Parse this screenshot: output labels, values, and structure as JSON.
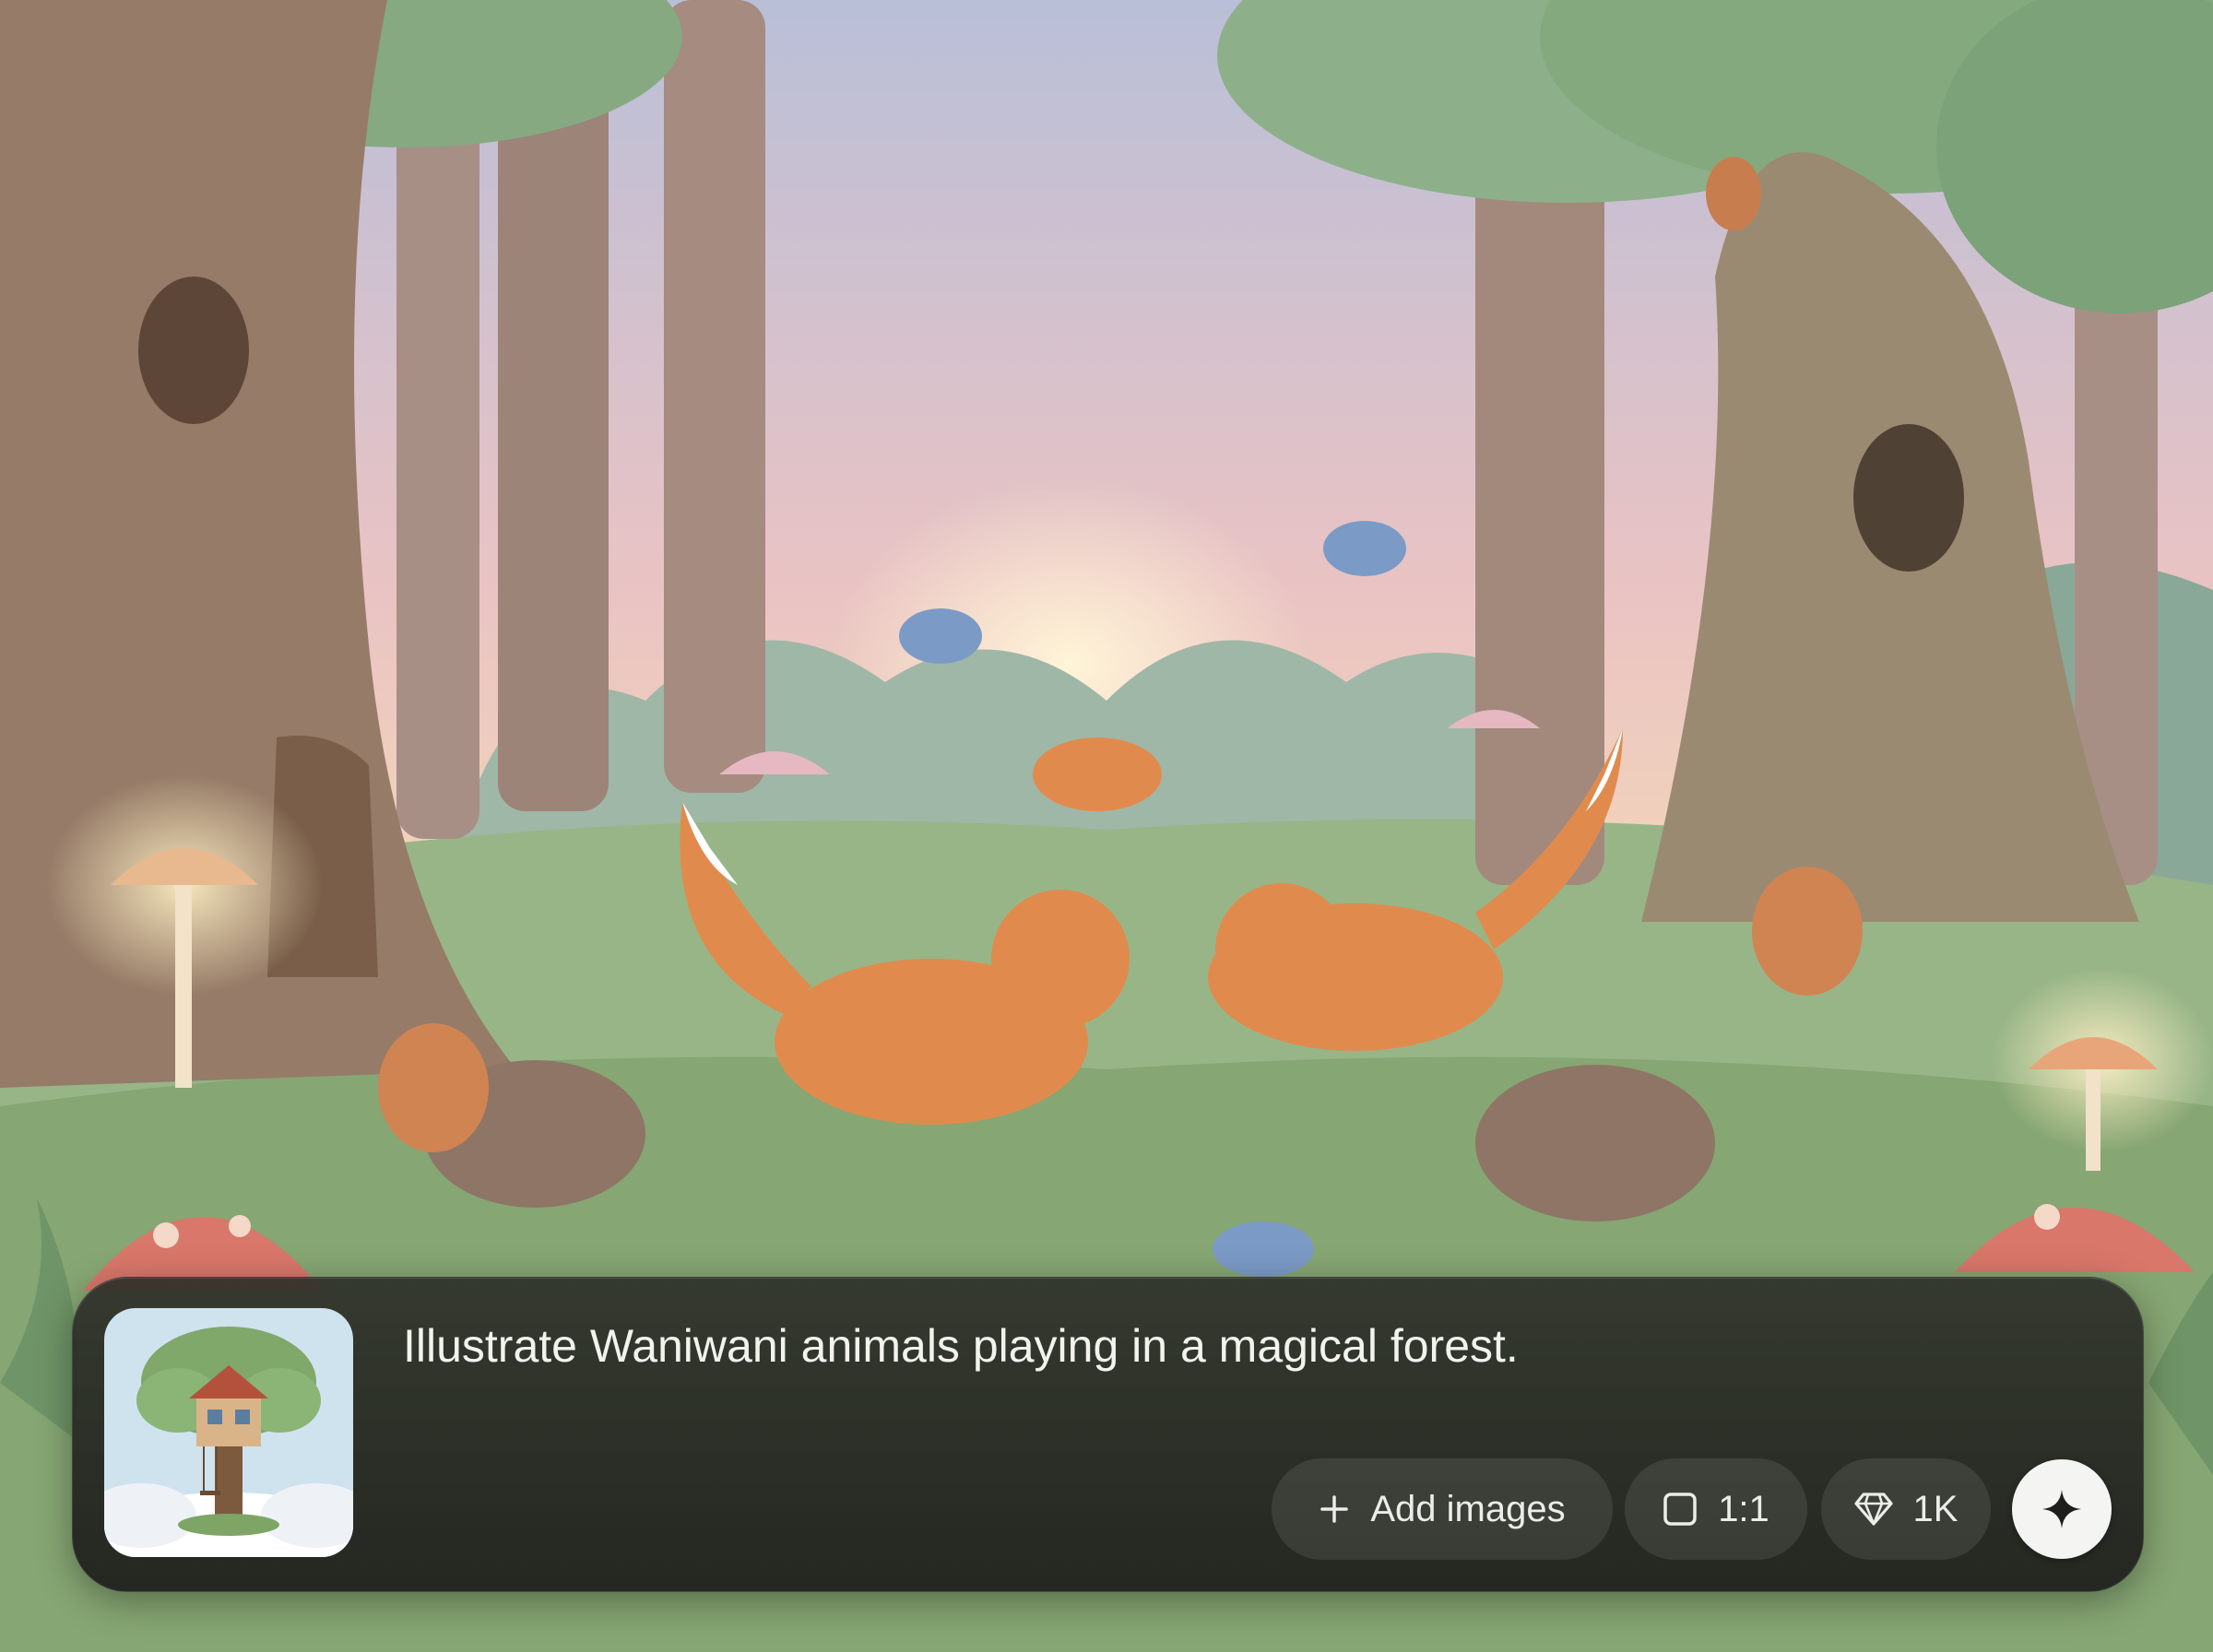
{
  "prompt_bar": {
    "thumbnail_icon": "treehouse-image",
    "prompt_text": "Illustrate Waniwani animals playing in a magical forest.",
    "add_images_label": "Add images",
    "add_icon": "plus-icon",
    "aspect_ratio_label": "1:1",
    "aspect_icon": "square-icon",
    "quality_label": "1K",
    "quality_icon": "diamond-icon",
    "generate_icon": "sparkle-icon"
  },
  "colors": {
    "panel_background": "#2a2b26",
    "pill_background": "#3d3e39",
    "text": "#f2f2ee",
    "generate_button": "#f4f4f2"
  }
}
